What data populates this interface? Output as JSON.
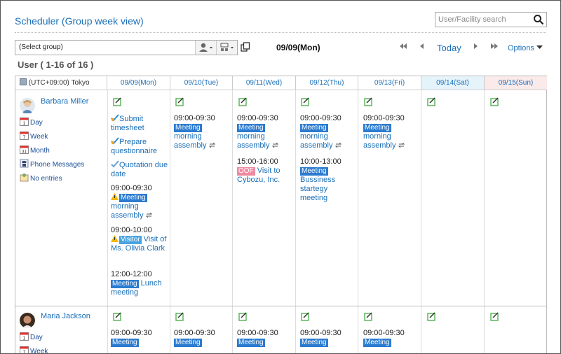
{
  "header": {
    "title": "Scheduler (Group week view)",
    "search_placeholder": "User/Facility search"
  },
  "toolbar": {
    "group_select": "(Select group)",
    "current_date": "09/09(Mon)",
    "today_label": "Today",
    "options_label": "Options"
  },
  "user_count": "User ( 1-16 of 16 )",
  "grid": {
    "timezone": "(UTC+09:00) Tokyo",
    "days": [
      "09/09(Mon)",
      "09/10(Tue)",
      "09/11(Wed)",
      "09/12(Thu)",
      "09/13(Fri)",
      "09/14(Sat)",
      "09/15(Sun)"
    ]
  },
  "users": [
    {
      "name": "Barbara Miller",
      "links": [
        "Day",
        "Week",
        "Month",
        "Phone Messages",
        "No entries"
      ]
    },
    {
      "name": "Maria Jackson",
      "links": [
        "Day",
        "Week"
      ]
    }
  ],
  "row1": {
    "mon": {
      "todos": [
        "Submit timesheet",
        "Prepare questionnaire",
        "Quotation due date"
      ],
      "events": [
        {
          "time": "09:00-09:30",
          "tag": "Meeting",
          "title": "morning assembly"
        },
        {
          "time": "09:00-10:00",
          "tag": "Visitor",
          "title": "Visit of Ms. Olivia Clark"
        },
        {
          "time": "12:00-12:00",
          "tag": "Meeting",
          "title": "Lunch meeting"
        }
      ]
    },
    "tue": {
      "time": "09:00-09:30",
      "tag": "Meeting",
      "title": "morning assembly"
    },
    "wed": [
      {
        "time": "09:00-09:30",
        "tag": "Meeting",
        "title": "morning assembly"
      },
      {
        "time": "15:00-16:00",
        "tag": "OOF",
        "title": "Visit to Cybozu, Inc."
      }
    ],
    "thu": [
      {
        "time": "09:00-09:30",
        "tag": "Meeting",
        "title": "morning assembly"
      },
      {
        "time": "10:00-13:00",
        "tag": "Meeting",
        "title": "Bussiness startegy meeting"
      }
    ],
    "fri": {
      "time": "09:00-09:30",
      "tag": "Meeting",
      "title": "morning assembly"
    }
  },
  "row2": {
    "time": "09:00-09:30",
    "tag": "Meeting"
  }
}
